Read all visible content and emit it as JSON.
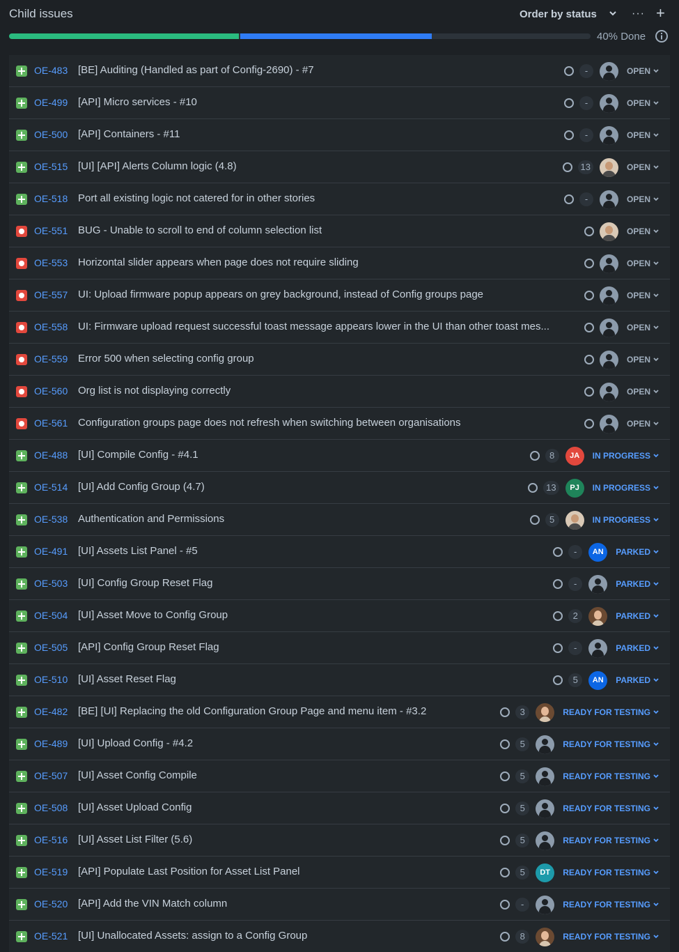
{
  "header": {
    "title": "Child issues",
    "order_label": "Order by status",
    "more_label": "···",
    "add_label": "+"
  },
  "progress": {
    "done_fraction": 0.395,
    "in_progress_fraction": 0.33,
    "done_text": "40% Done"
  },
  "colors": {
    "done": "#2abb7f",
    "in_progress": "#2f7cf5",
    "link": "#579dff",
    "bug": "#e2483d",
    "story": "#5eb25d"
  },
  "issues": [
    {
      "key": "OE-483",
      "type": "story",
      "summary": "[BE] Auditing (Handled as part of Config-2690) - #7",
      "estimate": "-",
      "avatar": "default",
      "status": "OPEN"
    },
    {
      "key": "OE-499",
      "type": "story",
      "summary": "[API] Micro services - #10",
      "estimate": "-",
      "avatar": "default",
      "status": "OPEN"
    },
    {
      "key": "OE-500",
      "type": "story",
      "summary": "[API] Containers - #11",
      "estimate": "-",
      "avatar": "default",
      "status": "OPEN"
    },
    {
      "key": "OE-515",
      "type": "story",
      "summary": "[UI] [API] Alerts Column logic (4.8)",
      "estimate": "13",
      "avatar": "photo",
      "status": "OPEN"
    },
    {
      "key": "OE-518",
      "type": "story",
      "summary": "Port all existing logic not catered for in other stories",
      "estimate": "-",
      "avatar": "default",
      "status": "OPEN"
    },
    {
      "key": "OE-551",
      "type": "bug",
      "summary": "BUG - Unable to scroll to end of column selection list",
      "estimate": "",
      "avatar": "photo",
      "status": "OPEN"
    },
    {
      "key": "OE-553",
      "type": "bug",
      "summary": "Horizontal slider appears when page does not require sliding",
      "estimate": "",
      "avatar": "default",
      "status": "OPEN"
    },
    {
      "key": "OE-557",
      "type": "bug",
      "summary": "UI: Upload firmware popup appears on grey background, instead of Config groups page",
      "estimate": "",
      "avatar": "default",
      "status": "OPEN"
    },
    {
      "key": "OE-558",
      "type": "bug",
      "summary": "UI: Firmware upload request successful toast message appears lower in the UI than other toast mes...",
      "estimate": "",
      "avatar": "default",
      "status": "OPEN"
    },
    {
      "key": "OE-559",
      "type": "bug",
      "summary": "Error 500 when selecting config group",
      "estimate": "",
      "avatar": "default",
      "status": "OPEN"
    },
    {
      "key": "OE-560",
      "type": "bug",
      "summary": "Org list is not displaying correctly",
      "estimate": "",
      "avatar": "default",
      "status": "OPEN"
    },
    {
      "key": "OE-561",
      "type": "bug",
      "summary": "Configuration groups page does not refresh when switching between organisations",
      "estimate": "",
      "avatar": "default",
      "status": "OPEN"
    },
    {
      "key": "OE-488",
      "type": "story",
      "summary": "[UI] Compile Config - #4.1",
      "estimate": "8",
      "avatar": "JA",
      "avatar_color": "#e2483d",
      "status": "IN PROGRESS"
    },
    {
      "key": "OE-514",
      "type": "story",
      "summary": "[UI] Add Config Group (4.7)",
      "estimate": "13",
      "avatar": "PJ",
      "avatar_color": "#1f845a",
      "status": "IN PROGRESS"
    },
    {
      "key": "OE-538",
      "type": "story",
      "summary": "Authentication and Permissions",
      "estimate": "5",
      "avatar": "photo",
      "status": "IN PROGRESS"
    },
    {
      "key": "OE-491",
      "type": "story",
      "summary": "[UI] Assets List Panel - #5",
      "estimate": "-",
      "avatar": "AN",
      "avatar_color": "#0c66e4",
      "status": "PARKED"
    },
    {
      "key": "OE-503",
      "type": "story",
      "summary": "[UI] Config Group Reset Flag",
      "estimate": "-",
      "avatar": "default",
      "status": "PARKED"
    },
    {
      "key": "OE-504",
      "type": "story",
      "summary": "[UI] Asset Move to Config Group",
      "estimate": "2",
      "avatar": "photo-f",
      "status": "PARKED"
    },
    {
      "key": "OE-505",
      "type": "story",
      "summary": "[API] Config Group Reset Flag",
      "estimate": "-",
      "avatar": "default",
      "status": "PARKED"
    },
    {
      "key": "OE-510",
      "type": "story",
      "summary": "[UI] Asset Reset Flag",
      "estimate": "5",
      "avatar": "AN",
      "avatar_color": "#0c66e4",
      "status": "PARKED"
    },
    {
      "key": "OE-482",
      "type": "story",
      "summary": "[BE] [UI] Replacing the old Configuration Group Page and menu item - #3.2",
      "estimate": "3",
      "avatar": "photo-f",
      "status": "READY FOR TESTING"
    },
    {
      "key": "OE-489",
      "type": "story",
      "summary": "[UI] Upload Config - #4.2",
      "estimate": "5",
      "avatar": "default",
      "status": "READY FOR TESTING"
    },
    {
      "key": "OE-507",
      "type": "story",
      "summary": "[UI] Asset Config Compile",
      "estimate": "5",
      "avatar": "default",
      "status": "READY FOR TESTING"
    },
    {
      "key": "OE-508",
      "type": "story",
      "summary": "[UI] Asset Upload Config",
      "estimate": "5",
      "avatar": "default",
      "status": "READY FOR TESTING"
    },
    {
      "key": "OE-516",
      "type": "story",
      "summary": "[UI] Asset List Filter (5.6)",
      "estimate": "5",
      "avatar": "default",
      "status": "READY FOR TESTING"
    },
    {
      "key": "OE-519",
      "type": "story",
      "summary": "[API] Populate Last Position for Asset List Panel",
      "estimate": "5",
      "avatar": "DT",
      "avatar_color": "#1d9aaa",
      "status": "READY FOR TESTING"
    },
    {
      "key": "OE-520",
      "type": "story",
      "summary": "[API] Add the VIN Match column",
      "estimate": "-",
      "avatar": "default",
      "status": "READY FOR TESTING"
    },
    {
      "key": "OE-521",
      "type": "story",
      "summary": "[UI] Unallocated Assets: assign to a Config Group",
      "estimate": "8",
      "avatar": "photo-f",
      "status": "READY FOR TESTING"
    }
  ]
}
